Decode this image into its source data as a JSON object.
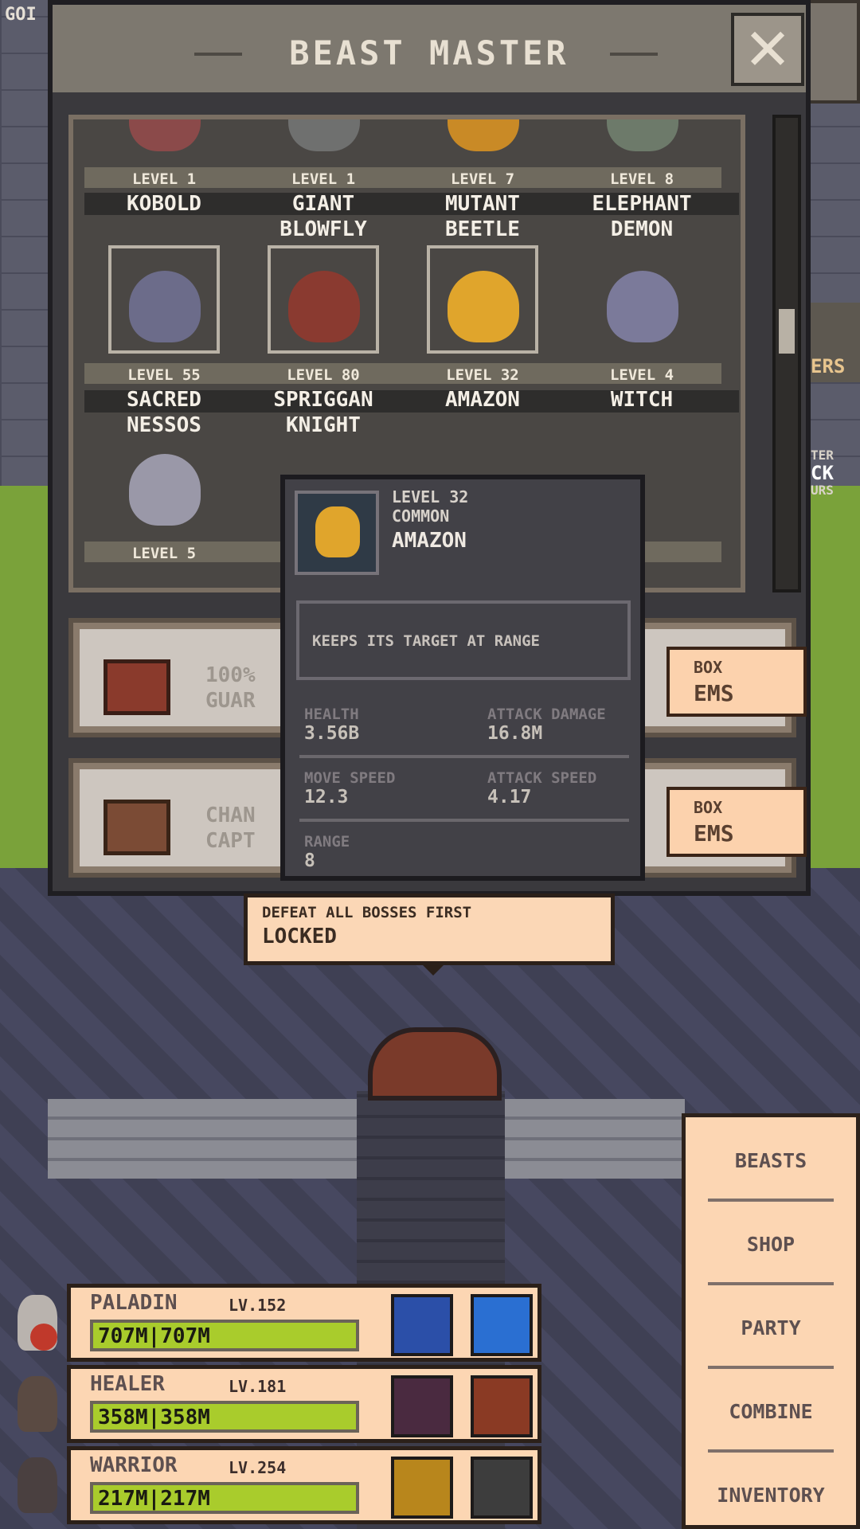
{
  "top_hud": {
    "gold_label": "GOI"
  },
  "panel": {
    "title": "BEAST MASTER"
  },
  "beasts": [
    {
      "level": "LEVEL 1",
      "name_line1": "KOBOLD",
      "name_line2": ""
    },
    {
      "level": "LEVEL 1",
      "name_line1": "GIANT",
      "name_line2": "BLOWFLY"
    },
    {
      "level": "LEVEL 7",
      "name_line1": "MUTANT",
      "name_line2": "BEETLE"
    },
    {
      "level": "LEVEL 8",
      "name_line1": "ELEPHANT",
      "name_line2": "DEMON"
    },
    {
      "level": "LEVEL 55",
      "name_line1": "SACRED",
      "name_line2": "NESSOS"
    },
    {
      "level": "LEVEL 80",
      "name_line1": "SPRIGGAN",
      "name_line2": "KNIGHT"
    },
    {
      "level": "LEVEL 32",
      "name_line1": "AMAZON",
      "name_line2": ""
    },
    {
      "level": "LEVEL 4",
      "name_line1": "WITCH",
      "name_line2": ""
    },
    {
      "level": "LEVEL 5",
      "name_line1": "",
      "name_line2": ""
    }
  ],
  "chests": [
    {
      "text_line1": "100%",
      "text_line2": "GUAR",
      "button_line1": "BOX",
      "button_line2": "EMS"
    },
    {
      "text_line1": "CHAN",
      "text_line2": "CAPT",
      "button_line1": "BOX",
      "button_line2": "EMS"
    }
  ],
  "tooltip": {
    "level": "LEVEL 32",
    "rarity": "COMMON",
    "name": "AMAZON",
    "description": "KEEPS ITS TARGET AT RANGE",
    "stats": {
      "health_label": "HEALTH",
      "health": "3.56B",
      "attack_damage_label": "ATTACK DAMAGE",
      "attack_damage": "16.8M",
      "move_speed_label": "MOVE SPEED",
      "move_speed": "12.3",
      "attack_speed_label": "ATTACK SPEED",
      "attack_speed": "4.17",
      "range_label": "RANGE",
      "range": "8"
    }
  },
  "locked_bubble": {
    "hint": "DEFEAT ALL BOSSES FIRST",
    "status": "LOCKED"
  },
  "side_fragments": {
    "a": "ERS",
    "b": "TER",
    "c": "CK",
    "d": "URS"
  },
  "menu": {
    "items": [
      "BEASTS",
      "SHOP",
      "PARTY",
      "COMBINE",
      "INVENTORY"
    ]
  },
  "party": [
    {
      "name": "PALADIN",
      "level": "LV.152",
      "hp": "707M|707M"
    },
    {
      "name": "HEALER",
      "level": "LV.181",
      "hp": "358M|358M"
    },
    {
      "name": "WARRIOR",
      "level": "LV.254",
      "hp": "217M|217M"
    }
  ],
  "colors": {
    "accent": "#fcd6b3",
    "hp_bar": "#a9cc2c",
    "panel": "#3a393d"
  }
}
